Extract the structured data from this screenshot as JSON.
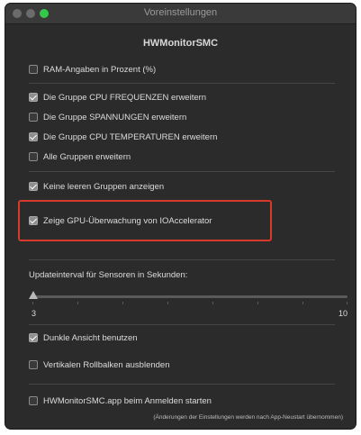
{
  "window": {
    "title": "Voreinstellungen"
  },
  "app": {
    "title": "HWMonitorSMC"
  },
  "options": {
    "ram_percent": {
      "label": "RAM-Angaben in Prozent (%)",
      "checked": false
    },
    "cpu_freq": {
      "label": "Die Gruppe CPU FREQUENZEN erweitern",
      "checked": true
    },
    "voltages": {
      "label": "Die Gruppe SPANNUNGEN erweitern",
      "checked": false
    },
    "cpu_temp": {
      "label": "Die Gruppe CPU TEMPERATUREN erweitern",
      "checked": true
    },
    "all_groups": {
      "label": "Alle Gruppen erweitern",
      "checked": false
    },
    "no_empty": {
      "label": "Keine leeren Gruppen anzeigen",
      "checked": true
    },
    "gpu_ioaccel": {
      "label": "Zeige GPU-Überwachung von IOAccelerator",
      "checked": true
    },
    "dark_mode": {
      "label": "Dunkle Ansicht benutzen",
      "checked": true
    },
    "vert_scroll": {
      "label": "Vertikalen Rollbalken ausblenden",
      "checked": false
    },
    "login_start": {
      "label": "HWMonitorSMC.app beim Anmelden starten",
      "checked": false
    }
  },
  "slider": {
    "label": "Updateinterval für Sensoren in Sekunden:",
    "min_label": "3",
    "max_label": "10",
    "value": 3
  },
  "note": "(Änderungen der Einstellungen werden nach App-Neustart übernommen)",
  "colors": {
    "highlight_border": "#d63a2a",
    "checkbox_checked": "#8e8e8e"
  }
}
